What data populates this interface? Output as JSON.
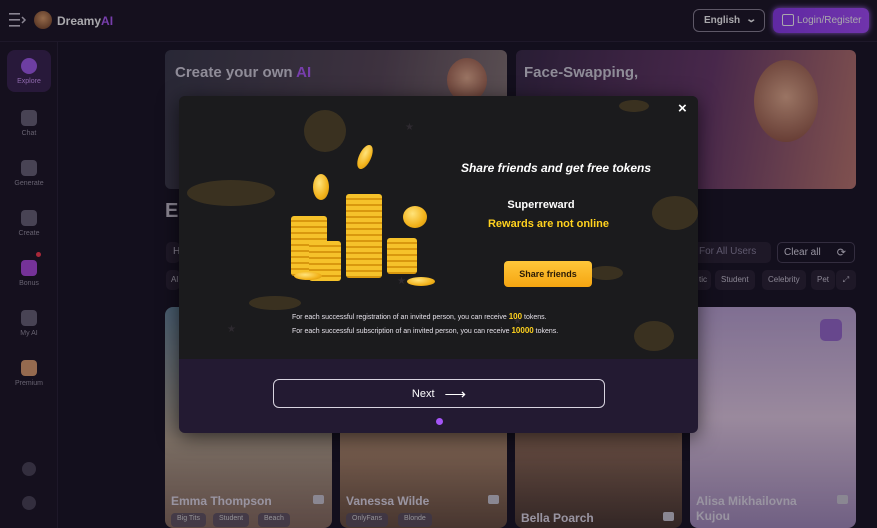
{
  "header": {
    "brand_main": "Dreamy",
    "brand_accent": "AI",
    "language": "English",
    "login_label": "Login/Register"
  },
  "sidebar": {
    "items": [
      {
        "label": "Explore",
        "active": true
      },
      {
        "label": "Chat"
      },
      {
        "label": "Generate"
      },
      {
        "label": "Create"
      },
      {
        "label": "Bonus",
        "badge": true
      },
      {
        "label": "My AI"
      },
      {
        "label": "Premium"
      }
    ]
  },
  "banners": {
    "left_title_main": "Create your own",
    "left_title_accent": "AI",
    "right_title": "Face-Swapping,"
  },
  "filters": {
    "section_letter": "E",
    "search_letter": "H",
    "category_letter": "Al",
    "users": "For All Users",
    "clear": "Clear all",
    "chips": [
      "tic",
      "Student",
      "Celebrity",
      "Pet"
    ]
  },
  "cards": [
    {
      "name": "Emma Thompson",
      "tags": [
        "Big Tits",
        "Student",
        "Beach"
      ]
    },
    {
      "name": "Vanessa Wilde",
      "tags": [
        "OnlyFans",
        "Blonde"
      ]
    },
    {
      "name": "Bella Poarch",
      "tags": []
    },
    {
      "name": "Alisa Mikhailovna Kujou",
      "tags": []
    }
  ],
  "modal": {
    "title": "Share friends and get free tokens",
    "reward_title": "Superreward",
    "reward_status": "Rewards are not online",
    "share_button": "Share friends",
    "note1_pre": "For each successful registration of an invited person, you can receive",
    "note1_value": "100",
    "note1_post": "tokens.",
    "note2_pre": "For each successful subscription of an invited person, you can receive",
    "note2_value": "10000",
    "note2_post": "tokens.",
    "next_label": "Next",
    "close_symbol": "×"
  },
  "colors": {
    "accent": "#a84dff",
    "gold": "#ffd21e",
    "background": "#1a1524"
  }
}
